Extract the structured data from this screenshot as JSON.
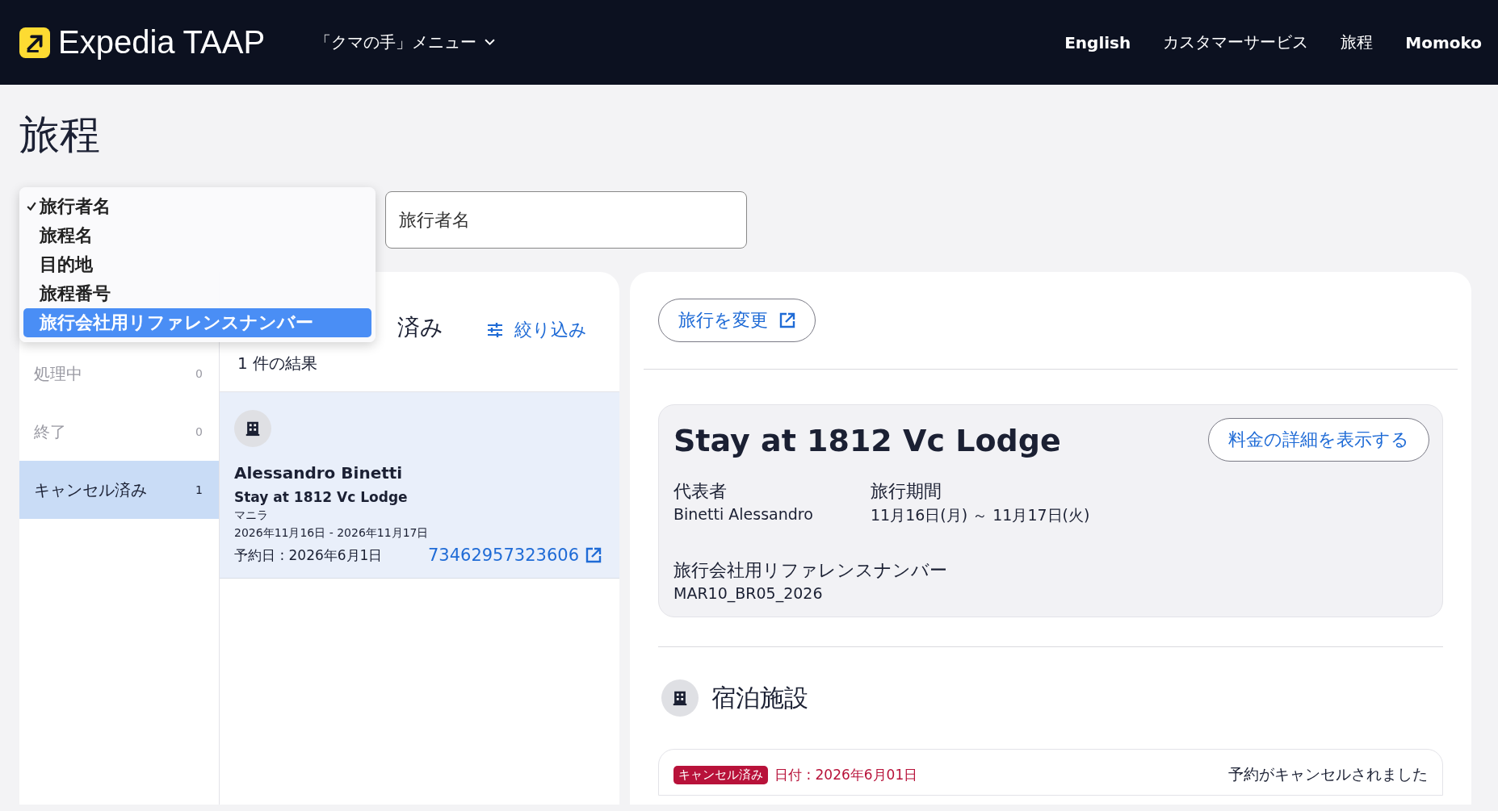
{
  "header": {
    "logo_text": "Expedia",
    "logo_suffix": "TAAP",
    "menu": "「クマの手」メニュー",
    "nav": [
      {
        "label": "English",
        "kind": "strong"
      },
      {
        "label": "カスタマーサービス",
        "kind": "plain"
      },
      {
        "label": "旅程",
        "kind": "plain"
      },
      {
        "label": "Momoko",
        "kind": "strong"
      }
    ]
  },
  "page_title": "旅程",
  "search_type_menu": [
    {
      "label": "旅行者名",
      "selected": true,
      "highlighted": false
    },
    {
      "label": "旅程名",
      "selected": false,
      "highlighted": false
    },
    {
      "label": "目的地",
      "selected": false,
      "highlighted": false
    },
    {
      "label": "旅程番号",
      "selected": false,
      "highlighted": false
    },
    {
      "label": "旅行会社用リファレンスナンバー",
      "selected": false,
      "highlighted": true
    }
  ],
  "search_field": {
    "placeholder": "旅行者名"
  },
  "status_filters": [
    {
      "label": "処理中",
      "count": "0",
      "selected": false
    },
    {
      "label": "終了",
      "count": "0",
      "selected": false
    },
    {
      "label": "キャンセル済み",
      "count": "1",
      "selected": true
    }
  ],
  "list": {
    "heading": "済み",
    "filter_button": "絞り込み",
    "result_count": "1 件の結果",
    "results": [
      {
        "traveler": "Alessandro Binetti",
        "title": "Stay at 1812 Vc Lodge",
        "destination": "マニラ",
        "dates": "2026年11月16日 - 2026年11月17日",
        "booked": "予約日 : 2026年6月1日",
        "itinerary_number": "73462957323606",
        "selected": true
      }
    ]
  },
  "detail": {
    "change_trip_button": "旅行を変更",
    "summary": {
      "title": "Stay at 1812 Vc Lodge",
      "price_button": "料金の詳細を表示する",
      "fields": [
        {
          "label": "代表者",
          "value": "Binetti Alessandro"
        },
        {
          "label": "旅行期間",
          "value": "11月16日(月) ～ 11月17日(火)"
        },
        {
          "label": "旅行会社用リファレンスナンバー",
          "value": "MAR10_BR05_2026"
        }
      ]
    },
    "section_title": "宿泊施設",
    "booking": {
      "status_badge": "キャンセル済み",
      "date": "日付 : 2026年6月01日",
      "message": "予約がキャンセルされました"
    }
  }
}
